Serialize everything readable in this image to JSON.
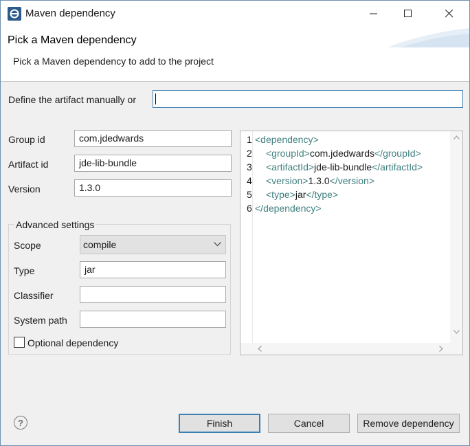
{
  "window": {
    "title": "Maven dependency"
  },
  "header": {
    "title": "Pick a Maven dependency",
    "description": "Pick a Maven dependency to add to the project"
  },
  "manual": {
    "label": "Define the artifact manually or",
    "value": ""
  },
  "form": {
    "group_label": "Group id",
    "group_value": "com.jdedwards",
    "artifact_label": "Artifact id",
    "artifact_value": "jde-lib-bundle",
    "version_label": "Version",
    "version_value": "1.3.0"
  },
  "advanced": {
    "title": "Advanced settings",
    "scope_label": "Scope",
    "scope_value": "compile",
    "type_label": "Type",
    "type_value": "jar",
    "classifier_label": "Classifier",
    "classifier_value": "",
    "syspath_label": "System path",
    "syspath_value": "",
    "optional_label": "Optional dependency",
    "optional_checked": false
  },
  "xml": {
    "line_numbers": [
      "1",
      "2",
      "3",
      "4",
      "5",
      "6"
    ],
    "lines": [
      {
        "open": "<dependency>",
        "text": "",
        "close": ""
      },
      {
        "open": "<groupId>",
        "text": "com.jdedwards",
        "close": "</groupId>"
      },
      {
        "open": "<artifactId>",
        "text": "jde-lib-bundle",
        "close": "</artifactId>"
      },
      {
        "open": "<version>",
        "text": "1.3.0",
        "close": "</version>"
      },
      {
        "open": "<type>",
        "text": "jar",
        "close": "</type>"
      },
      {
        "open": "</dependency>",
        "text": "",
        "close": ""
      }
    ]
  },
  "footer": {
    "help": "?",
    "finish": "Finish",
    "cancel": "Cancel",
    "remove": "Remove dependency"
  },
  "colors": {
    "accent": "#3c7fb1",
    "xml_tag": "#3f7f7f"
  }
}
